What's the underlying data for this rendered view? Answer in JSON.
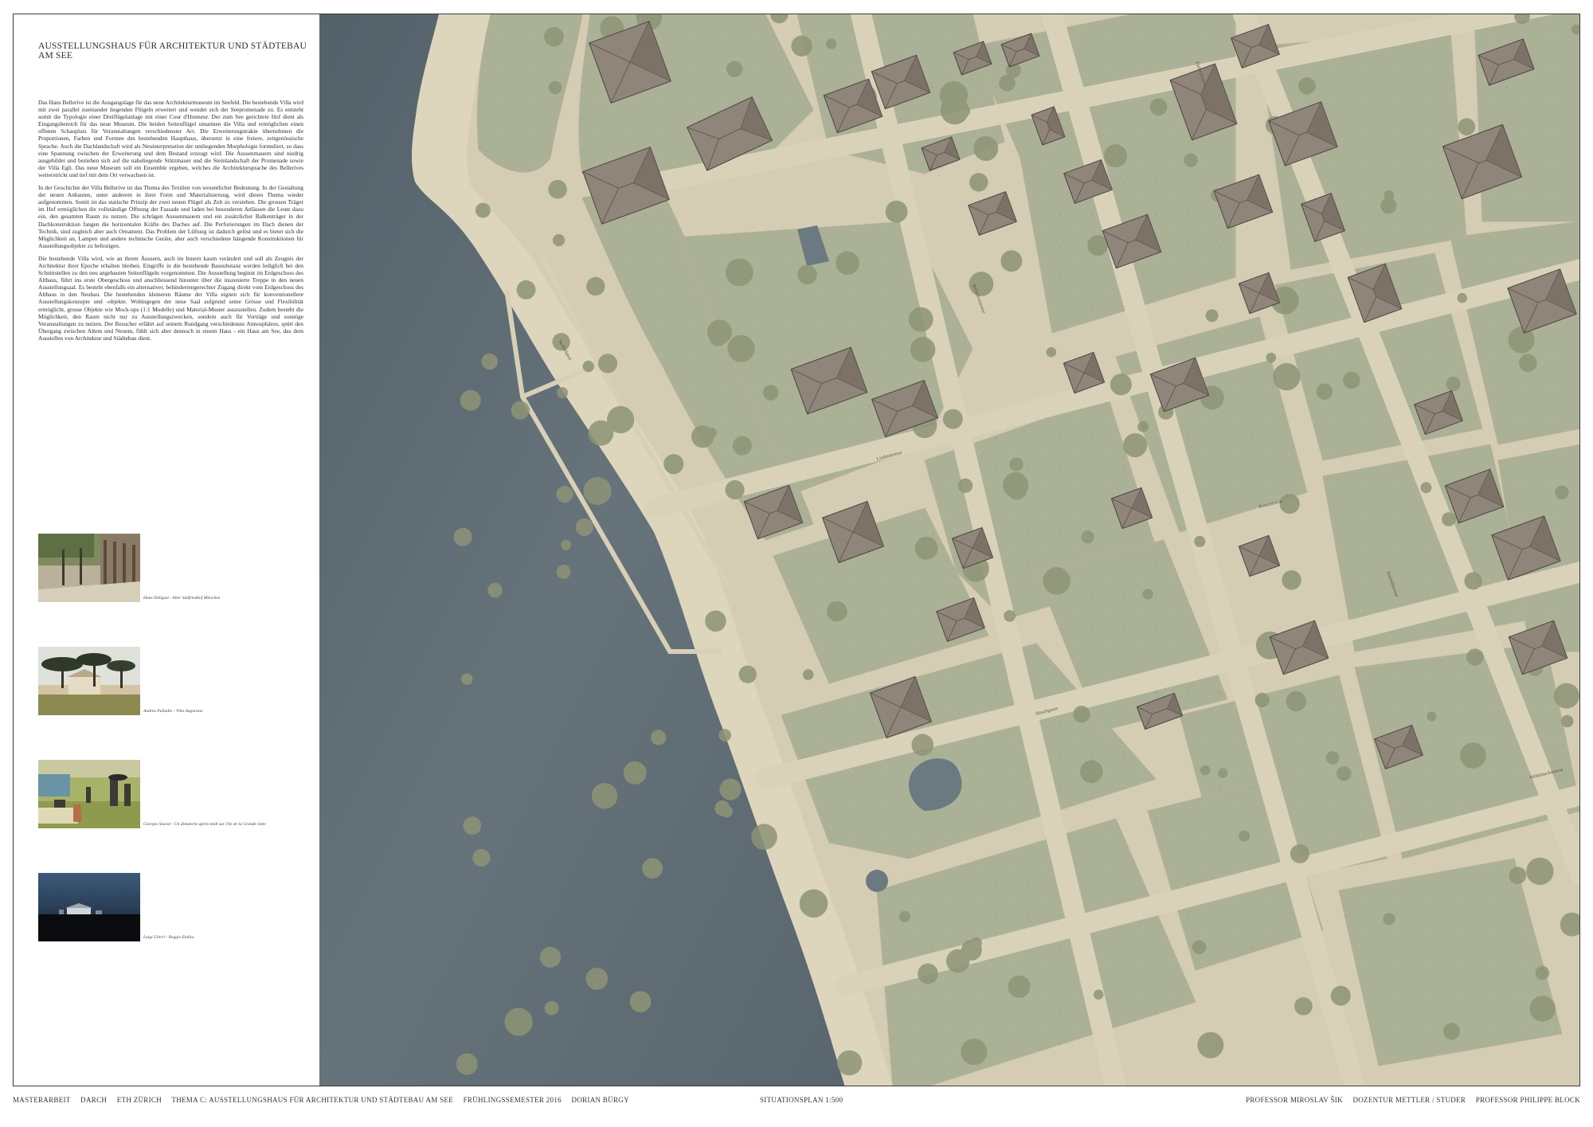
{
  "poster": {
    "title": "Ausstellungshaus für Architektur und Städtebau am See",
    "paragraphs": [
      "Das Haus Bellerive ist die Ausgangslage für das neue Architekturmuseum im Seefeld. Die bestehende Villa wird mit zwei parallel zueinander liegenden Flügeln erweitert und wendet sich der Seepromenade zu. Es entsteht somit die Typologie einer Dreiflügelanlage mit einer Cour d'Honneur. Der zum See gerichtete Hof dient als Eingangsbereich für das neue Museum. Die beiden Seitenflügel umarmen die Villa und ermöglichen einen offenen Schauplatz für Veranstaltungen verschiedenster Art. Die Erweiterungstrakte übernehmen die Proportionen, Farben und Formen des bestehenden Haupthaus, übersetzt in eine freiere, zeitgenössische Sprache. Auch die Dachlandschaft wird als Neuinterpretation der umliegenden Morphologie formuliert, so dass eine Spannung zwischen der Erweiterung und dem Bestand erzeugt wird. Die Aussenmauern sind niedrig ausgebildet und beziehen sich auf die naheliegende Stützmauer und die Steinlandschaft der Promenade sowie der Villa Egli. Das neue Museum soll ein Ensemble ergeben, welches die Architektursprache des Bellerives weiterstrickt und tief mit dem Ort verwachsen ist.",
      "In der Geschichte der Villa Bellerive ist das Thema des Textilen von wesentlicher Bedeutung. In der Gestaltung der neuen Anbauten, unter anderem in ihrer Form und Materialisierung, wird dieses Thema wieder aufgenommen. Somit ist das statische Prinzip der zwei neuen Flügel als Zelt zu verstehen. Die grossen Träger im Hof ermöglichen die vollständige Öffnung der Fassade und laden bei besonderen Anlässen die Leute dazu ein, den gesamten Raum zu nutzen. Die schrägen Aussenmauern und ein zusätzlicher Balkenträger in der Dachkonstruktion fangen die horizontalen Kräfte des Daches auf. Die Perforierungen im Dach dienen der Technik, sind zugleich aber auch Ornament. Das Problem der Lüftung ist dadurch gelöst und es bietet sich die Möglichkeit an, Lampen und andere technische Geräte, aber auch verschiedene hängende Konstruktionen für Ausstellungsobjekte zu befestigen.",
      "Die bestehende Villa wird, wie an ihrem Äussern, auch im Innern kaum verändert und soll als Zeugnis der Architektur ihrer Epoche erhalten bleiben. Eingriffe in die bestehende Bausubstanz werden lediglich bei den Schnittstellen zu den neu angebauten Seitenflügeln vorgenommen. Die Ausstellung beginnt im Erdgeschoss des Altbaus, führt ins erste Obergeschoss und anschliessend hinunter über die inszenierte Treppe in den neuen Ausstellungsaal. Es besteht ebenfalls ein alternativer, behindertengerechter Zugang direkt vom Erdgeschoss des Altbaus in den Neubau. Die bestehenden kleineren Räume der Villa eignen sich für konventionellere Ausstellungskonzepte und -objekte. Wohingegen der neue Saal aufgrund seine Grösse und Flexibilität ermöglicht, grosse Objekte wie Mock-ups (1:1 Modelle) und Material-Muster auszustellen. Zudem besteht die Möglichkeit, den Raum nicht nur zu Ausstellungszwecken, sondern auch für Vorträge und sonstige Veranstaltungen zu nutzen. Der Besucher erfährt auf seinem Rundgang verschiedenste Atmosphären, spürt den Übergang zwischen Altem und Neuem, fühlt sich aber dennoch in einem Haus - ein Haus am See, das dem Ausstellen von Architektur und Städtebau dient."
    ],
    "references": [
      {
        "caption": "Hans Döllgast - Alter Südfriedhof München"
      },
      {
        "caption": "Andrea Palladio - Villa Angarano"
      },
      {
        "caption": "Georges Seurat - Un dimanche après-midi sur l'île de la Grande Jatte"
      },
      {
        "caption": "Luigi Ghirri - Reggio Emilia"
      }
    ]
  },
  "map": {
    "street_labels": [
      "Bellerivestrasse",
      "Seefeldquai",
      "Färberstrasse",
      "Höschgasse",
      "Kreuzstrasse",
      "Seefeldstrasse",
      "Lindenstrasse",
      "Mühlebachstrasse"
    ]
  },
  "footer": {
    "left": [
      "Masterarbeit",
      "DArch",
      "ETH Zürich",
      "Thema C: Ausstellungshaus für Architektur und Städtebau am See",
      "Frühlingssemester 2016",
      "Dorian Bürgy"
    ],
    "center": "Situationsplan 1:500",
    "right": [
      "Professor Miroslav Šik",
      "Dozentur Mettler / Studer",
      "Professor Philippe Block"
    ]
  },
  "colors": {
    "water": "#5f6b72",
    "promenade": "#d9d1b8",
    "lawn": "#a8ae94",
    "roof": "#8f857a",
    "street": "#d6ceb4"
  }
}
